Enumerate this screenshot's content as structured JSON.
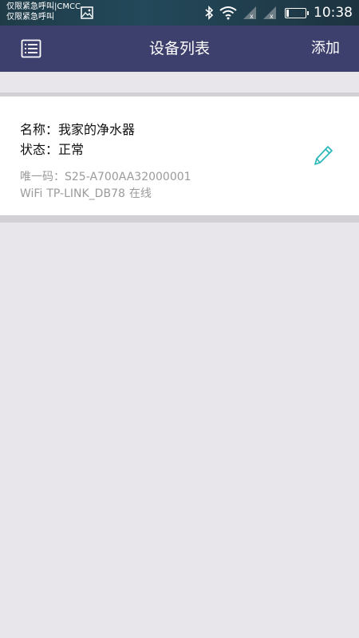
{
  "status_bar": {
    "carrier_line1": "仅限紧急呼叫|CMCC",
    "carrier_line2": "仅限紧急呼叫",
    "time": "10:38",
    "battery_level": 0.1
  },
  "header": {
    "title": "设备列表",
    "add_label": "添加",
    "background": "#3d3f6c"
  },
  "device": {
    "name_label": "名称：",
    "name_value": "我家的净水器",
    "state_label": "状态：",
    "state_value": "正常",
    "uid_label": "唯一码：",
    "uid_value": "S25-A700AA32000001",
    "network_label": "WiFi",
    "network_value": "TP-LINK_DB78",
    "online_status": "在线"
  },
  "colors": {
    "edit_accent": "#2ab7b9"
  },
  "icons": [
    "image-icon",
    "bluetooth-icon",
    "wifi-icon",
    "signal-icon",
    "battery-icon",
    "list-menu-icon",
    "pencil-icon"
  ]
}
